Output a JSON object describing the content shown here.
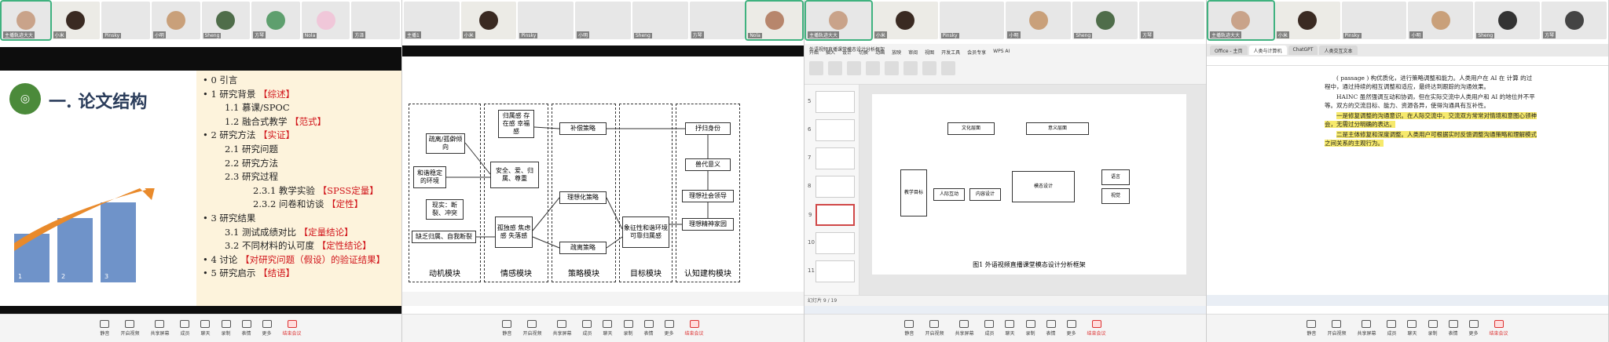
{
  "panes": [
    {
      "participants": [
        "主播轨迹大大",
        "小米",
        "Pinsky",
        "小明",
        "Sheng",
        "方琴",
        "Nola",
        "方泽"
      ],
      "slide": {
        "title": "一. 论文结构",
        "outline": [
          {
            "level": 1,
            "text": "• 0 引言",
            "tag": ""
          },
          {
            "level": 1,
            "text": "• 1 研究背景",
            "tag": "【综述】"
          },
          {
            "level": 2,
            "text": "1.1 慕课/SPOC",
            "tag": ""
          },
          {
            "level": 2,
            "text": "1.2 融合式教学",
            "tag": "【范式】"
          },
          {
            "level": 1,
            "text": "• 2 研究方法",
            "tag": "【实证】"
          },
          {
            "level": 2,
            "text": "2.1 研究问题",
            "tag": ""
          },
          {
            "level": 2,
            "text": "2.2 研究方法",
            "tag": ""
          },
          {
            "level": 2,
            "text": "2.3 研究过程",
            "tag": ""
          },
          {
            "level": 3,
            "text": "2.3.1 教学实验",
            "tag": "【SPSS定量】"
          },
          {
            "level": 3,
            "text": "2.3.2 问卷和访谈",
            "tag": "【定性】"
          },
          {
            "level": 1,
            "text": "• 3 研究结果",
            "tag": ""
          },
          {
            "level": 2,
            "text": "3.1 测试成绩对比",
            "tag": "【定量结论】"
          },
          {
            "level": 2,
            "text": "3.2 不同材料的认可度",
            "tag": "【定性结论】"
          },
          {
            "level": 1,
            "text": "• 4 讨论",
            "tag": "【对研究问题（假设）的验证结果】"
          },
          {
            "level": 1,
            "text": "• 5 研究启示",
            "tag": "【结语】"
          }
        ],
        "bar_labels": [
          "1",
          "2",
          "3"
        ]
      }
    },
    {
      "participants": [
        "主播1",
        "小米",
        "Pinsky",
        "小明",
        "Sheng",
        "方琴",
        "Nola"
      ],
      "diagram": {
        "modules": [
          "动机模块",
          "情感模块",
          "策略模块",
          "目标模块",
          "认知建构模块"
        ],
        "boxes": {
          "b1": "疏离/孤僻倾向",
          "b2": "和谐稳定的环境",
          "b3": "现实：断裂、冲突",
          "b4": "缺乏归属、自我断裂",
          "b5": "归属感 存在感 幸福感",
          "b6": "安全、爱、归属、尊重",
          "b7": "孤独感 焦虑感 失落感",
          "b8": "补偿策略",
          "b9": "理想化策略",
          "b10": "疏离策略",
          "b11": "象征性和谐环境 可靠归属感",
          "b12": "抒归身份",
          "b13": "兽代意义",
          "b14": "理想社会领导",
          "b15": "理想精神家园"
        }
      }
    },
    {
      "participants": [
        "主播轨迹大大",
        "小米",
        "Pinsky",
        "小明",
        "Sheng",
        "方琴"
      ],
      "app_title": "外语视频直播课堂模态设计分析框架",
      "menu": [
        "开始",
        "插入",
        "设计",
        "切换",
        "动画",
        "放映",
        "审阅",
        "视图",
        "开发工具",
        "会员专享",
        "WPS AI"
      ],
      "figure_caption": "图1 外语视频直播课堂模态设计分析框架",
      "status": "幻灯片 9 / 19",
      "slide_numbers": [
        "5",
        "6",
        "7",
        "8",
        "9",
        "10",
        "11"
      ],
      "fig_boxes": [
        "文化层面",
        "意义层面",
        "教学目标",
        "人际互动",
        "内容设计",
        "模态设计",
        "语言",
        "视觉"
      ]
    },
    {
      "participants": [
        "主播轨迹大大",
        "小米",
        "Pinsky",
        "小明",
        "Sheng",
        "方琴"
      ],
      "tabs": [
        "Office - 主页",
        "人类与计算机",
        "ChatGPT",
        "人类交互文本"
      ],
      "paragraphs": [
        "( passage ) 构优质化，进行策略调整和能力。人类用户在 AI 在 计算 的过程中，通过持续的相互调整和适应，最终达到跟踪的沟通效果。",
        "HAINC 虽然强调互动和协调，但在实际交流中人类用户和 AI 的地位并不平等。双方的交流目标、能力、资源各异，使得沟通具有互补性。",
        "一是修复调整的沟通意识。在人际交流中，交流双方常常对情境和意图心领神会，无需过分明确的表达。",
        "二是主体修复和深度调整。人类用户可根据实时反馈调整沟通策略和理解模式之间关系的主观行为。"
      ]
    }
  ],
  "toolbar": [
    "静音",
    "开启视频",
    "共享屏幕",
    "成员",
    "聊天",
    "录制",
    "表情",
    "更多",
    "结束会议"
  ]
}
